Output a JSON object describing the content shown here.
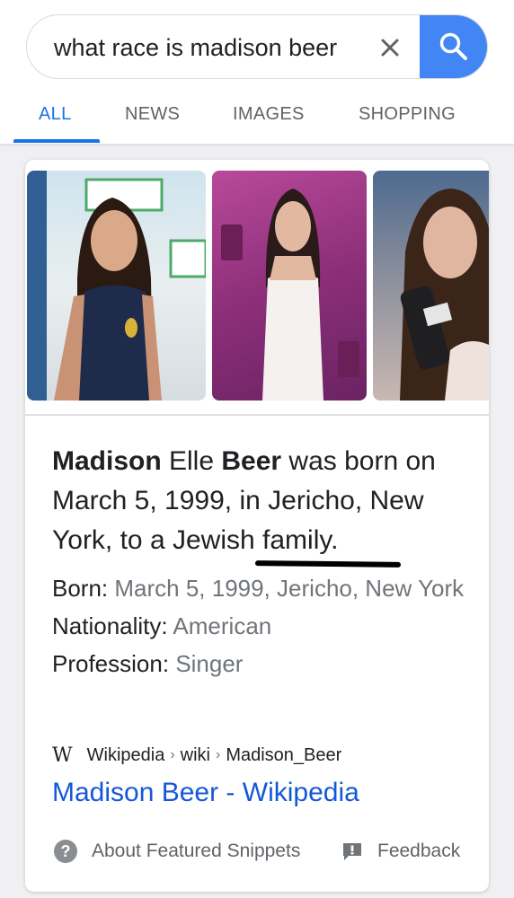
{
  "search": {
    "query": "what race is madison beer",
    "clear_icon": "close-icon",
    "search_icon": "search-icon",
    "accent_color": "#4285f4"
  },
  "tabs": [
    {
      "label": "ALL",
      "active": true
    },
    {
      "label": "NEWS",
      "active": false
    },
    {
      "label": "IMAGES",
      "active": false
    },
    {
      "label": "SHOPPING",
      "active": false
    }
  ],
  "snippet": {
    "summary": {
      "name_first": "Madison",
      "name_middle": " Elle ",
      "name_last": "Beer",
      "rest_1": " was born on March 5, 1999, in Jericho, New York, to a ",
      "highlight": "Jewish family",
      "rest_2": "."
    },
    "facts": [
      {
        "label": "Born:",
        "value": "March 5, 1999, Jericho, New York"
      },
      {
        "label": "Nationality:",
        "value": "American"
      },
      {
        "label": "Profession:",
        "value": "Singer"
      }
    ],
    "source": {
      "icon": "wikipedia-w-icon",
      "glyph": "W",
      "site": "Wikipedia",
      "path_1": "wiki",
      "path_2": "Madison_Beer"
    },
    "result_title": "Madison Beer - Wikipedia",
    "footer": {
      "about_label": "About Featured Snippets",
      "feedback_label": "Feedback",
      "about_glyph": "?"
    }
  },
  "colors": {
    "link": "#1558d6",
    "tab_active": "#1a73e8",
    "muted": "#70757a"
  }
}
